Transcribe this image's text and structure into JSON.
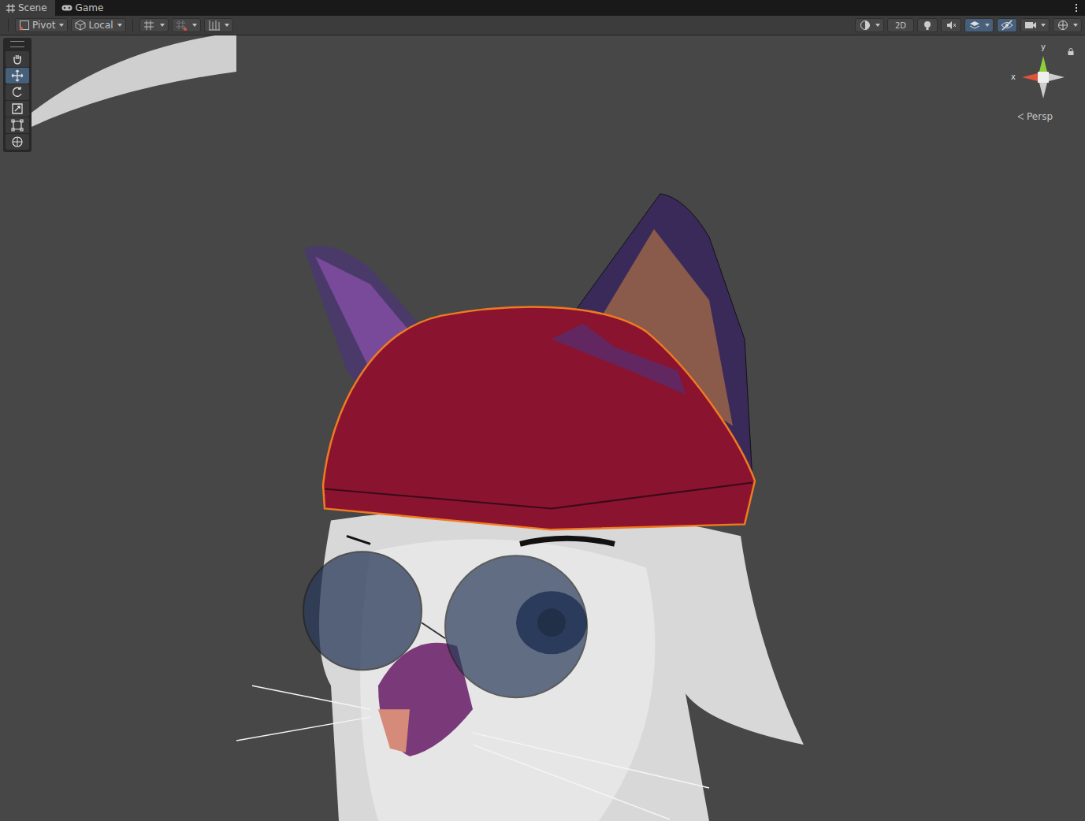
{
  "tabs": [
    {
      "label": "Scene",
      "selected": true,
      "kind": "scene"
    },
    {
      "label": "Game",
      "selected": false,
      "kind": "game"
    }
  ],
  "toolbar": {
    "left": [
      {
        "label": "Pivot",
        "kind": "pivot"
      },
      {
        "label": "Local",
        "kind": "local"
      }
    ],
    "snapping": [
      {
        "kind": "grid-snap"
      },
      {
        "kind": "grid"
      },
      {
        "kind": "increment"
      }
    ],
    "view_options": [
      {
        "kind": "shading",
        "on": false,
        "dropdown": true
      },
      {
        "kind": "2d",
        "label": "2D",
        "on": false,
        "dropdown": false
      },
      {
        "kind": "lighting",
        "on": false,
        "dropdown": false
      },
      {
        "kind": "audio",
        "on": false,
        "dropdown": false
      },
      {
        "kind": "effects",
        "on": true,
        "dropdown": true
      },
      {
        "kind": "hidden",
        "on": true,
        "dropdown": false
      },
      {
        "kind": "camera",
        "on": false,
        "dropdown": true
      },
      {
        "kind": "gizmos",
        "on": false,
        "dropdown": true
      }
    ]
  },
  "tools": [
    {
      "kind": "hand",
      "selected": false
    },
    {
      "kind": "move",
      "selected": true
    },
    {
      "kind": "rotate",
      "selected": false
    },
    {
      "kind": "scale",
      "selected": false
    },
    {
      "kind": "rect",
      "selected": false
    },
    {
      "kind": "transform",
      "selected": false
    }
  ],
  "gizmo": {
    "axes": [
      "y",
      "x"
    ],
    "projection": "Persp",
    "locked": true
  }
}
